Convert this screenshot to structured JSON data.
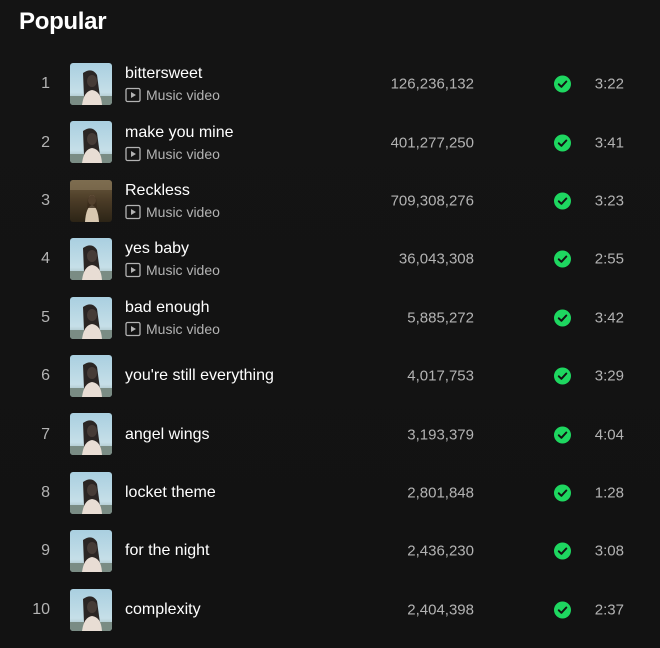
{
  "section": {
    "title": "Popular"
  },
  "colors": {
    "background": "#121212",
    "accent_green": "#1ed760",
    "secondary_text": "#b3b3b3",
    "primary_text": "#ffffff"
  },
  "music_video_label": "Music video",
  "tracks": [
    {
      "rank": "1",
      "title": "bittersweet",
      "music_video": true,
      "plays": "126,236,132",
      "saved": true,
      "duration": "3:22",
      "cover": "blue-sky-portrait"
    },
    {
      "rank": "2",
      "title": "make you mine",
      "music_video": true,
      "plays": "401,277,250",
      "saved": true,
      "duration": "3:41",
      "cover": "blue-sky-portrait"
    },
    {
      "rank": "3",
      "title": "Reckless",
      "music_video": true,
      "plays": "709,308,276",
      "saved": true,
      "duration": "3:23",
      "cover": "field-portrait"
    },
    {
      "rank": "4",
      "title": "yes baby",
      "music_video": true,
      "plays": "36,043,308",
      "saved": true,
      "duration": "2:55",
      "cover": "blue-sky-portrait"
    },
    {
      "rank": "5",
      "title": "bad enough",
      "music_video": true,
      "plays": "5,885,272",
      "saved": true,
      "duration": "3:42",
      "cover": "blue-sky-portrait"
    },
    {
      "rank": "6",
      "title": "you're still everything",
      "music_video": false,
      "plays": "4,017,753",
      "saved": true,
      "duration": "3:29",
      "cover": "blue-sky-portrait"
    },
    {
      "rank": "7",
      "title": "angel wings",
      "music_video": false,
      "plays": "3,193,379",
      "saved": true,
      "duration": "4:04",
      "cover": "blue-sky-portrait"
    },
    {
      "rank": "8",
      "title": "locket theme",
      "music_video": false,
      "plays": "2,801,848",
      "saved": true,
      "duration": "1:28",
      "cover": "blue-sky-portrait"
    },
    {
      "rank": "9",
      "title": "for the night",
      "music_video": false,
      "plays": "2,436,230",
      "saved": true,
      "duration": "3:08",
      "cover": "blue-sky-portrait"
    },
    {
      "rank": "10",
      "title": "complexity",
      "music_video": false,
      "plays": "2,404,398",
      "saved": true,
      "duration": "2:37",
      "cover": "blue-sky-portrait"
    }
  ]
}
